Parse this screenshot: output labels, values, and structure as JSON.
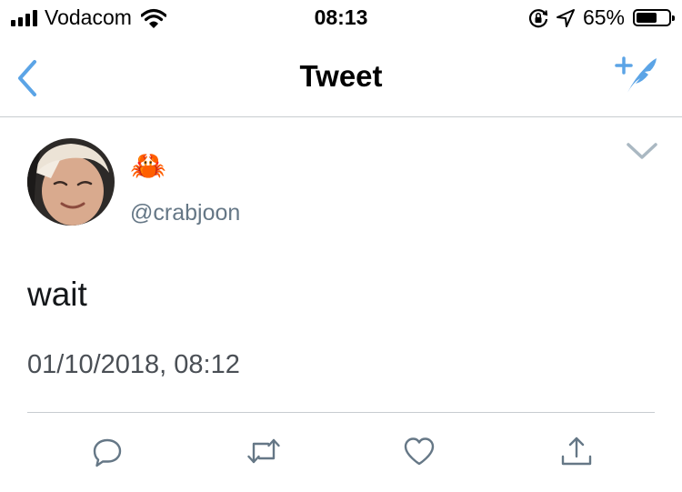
{
  "status_bar": {
    "carrier": "Vodacom",
    "time": "08:13",
    "battery_percent": "65%",
    "battery_level": 0.65,
    "icons": [
      "signal-icon",
      "wifi-icon",
      "orientation-lock-icon",
      "location-icon",
      "battery-icon"
    ]
  },
  "nav": {
    "title": "Tweet",
    "back_icon": "chevron-left-icon",
    "compose_icon": "compose-tweet-icon",
    "accent_color": "#5ba4e6"
  },
  "tweet": {
    "display_name": "🦀",
    "handle": "@crabjoon",
    "text": "wait",
    "timestamp": "01/10/2018, 08:12",
    "more_icon": "chevron-down-icon"
  },
  "actions": [
    {
      "icon": "reply-icon"
    },
    {
      "icon": "retweet-icon"
    },
    {
      "icon": "like-icon"
    },
    {
      "icon": "share-icon"
    }
  ]
}
